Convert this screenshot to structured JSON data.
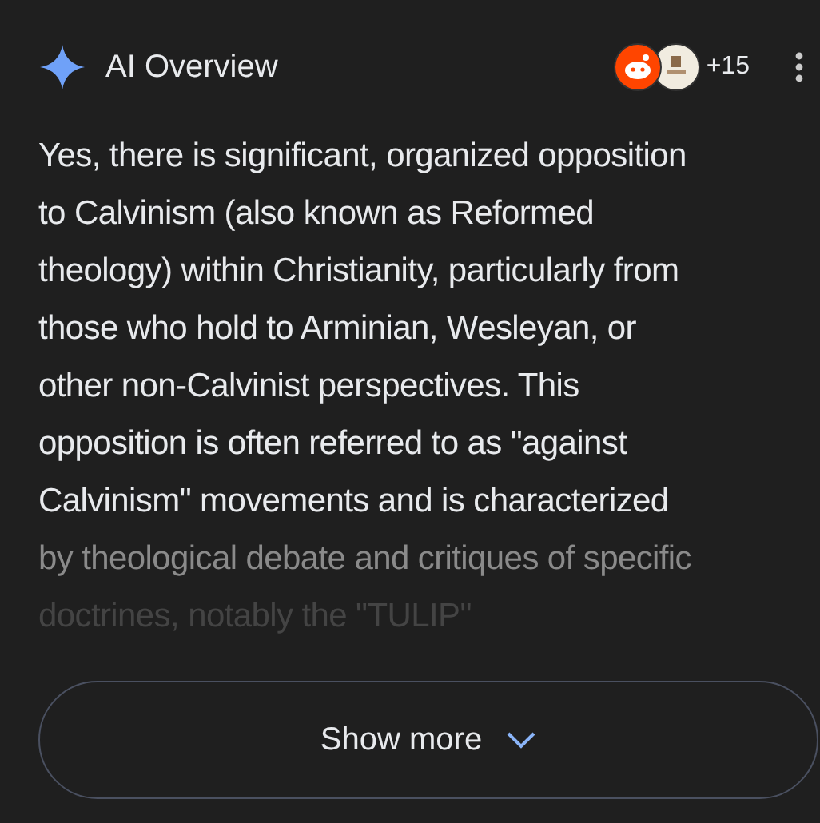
{
  "header": {
    "title": "AI Overview",
    "source_count": "+15"
  },
  "lines": [
    {
      "text": "Yes, there is significant, organized opposition",
      "kind": "normal"
    },
    {
      "text": "to Calvinism (also known as Reformed",
      "kind": "normal"
    },
    {
      "text": "theology) within Christianity, particularly from",
      "kind": "normal"
    },
    {
      "text": "those who hold to Arminian, Wesleyan, or",
      "kind": "normal"
    },
    {
      "text": "other non-Calvinist perspectives. This",
      "kind": "normal"
    },
    {
      "text": "opposition is often referred to as \"against",
      "kind": "normal"
    },
    {
      "text": "Calvinism\" movements and is characterized",
      "kind": "normal"
    },
    {
      "text": "by theological debate and critiques of specific",
      "kind": "faded"
    },
    {
      "text": "doctrines, notably the \"TULIP\"",
      "kind": "faint"
    }
  ],
  "button": {
    "label": "Show more"
  }
}
